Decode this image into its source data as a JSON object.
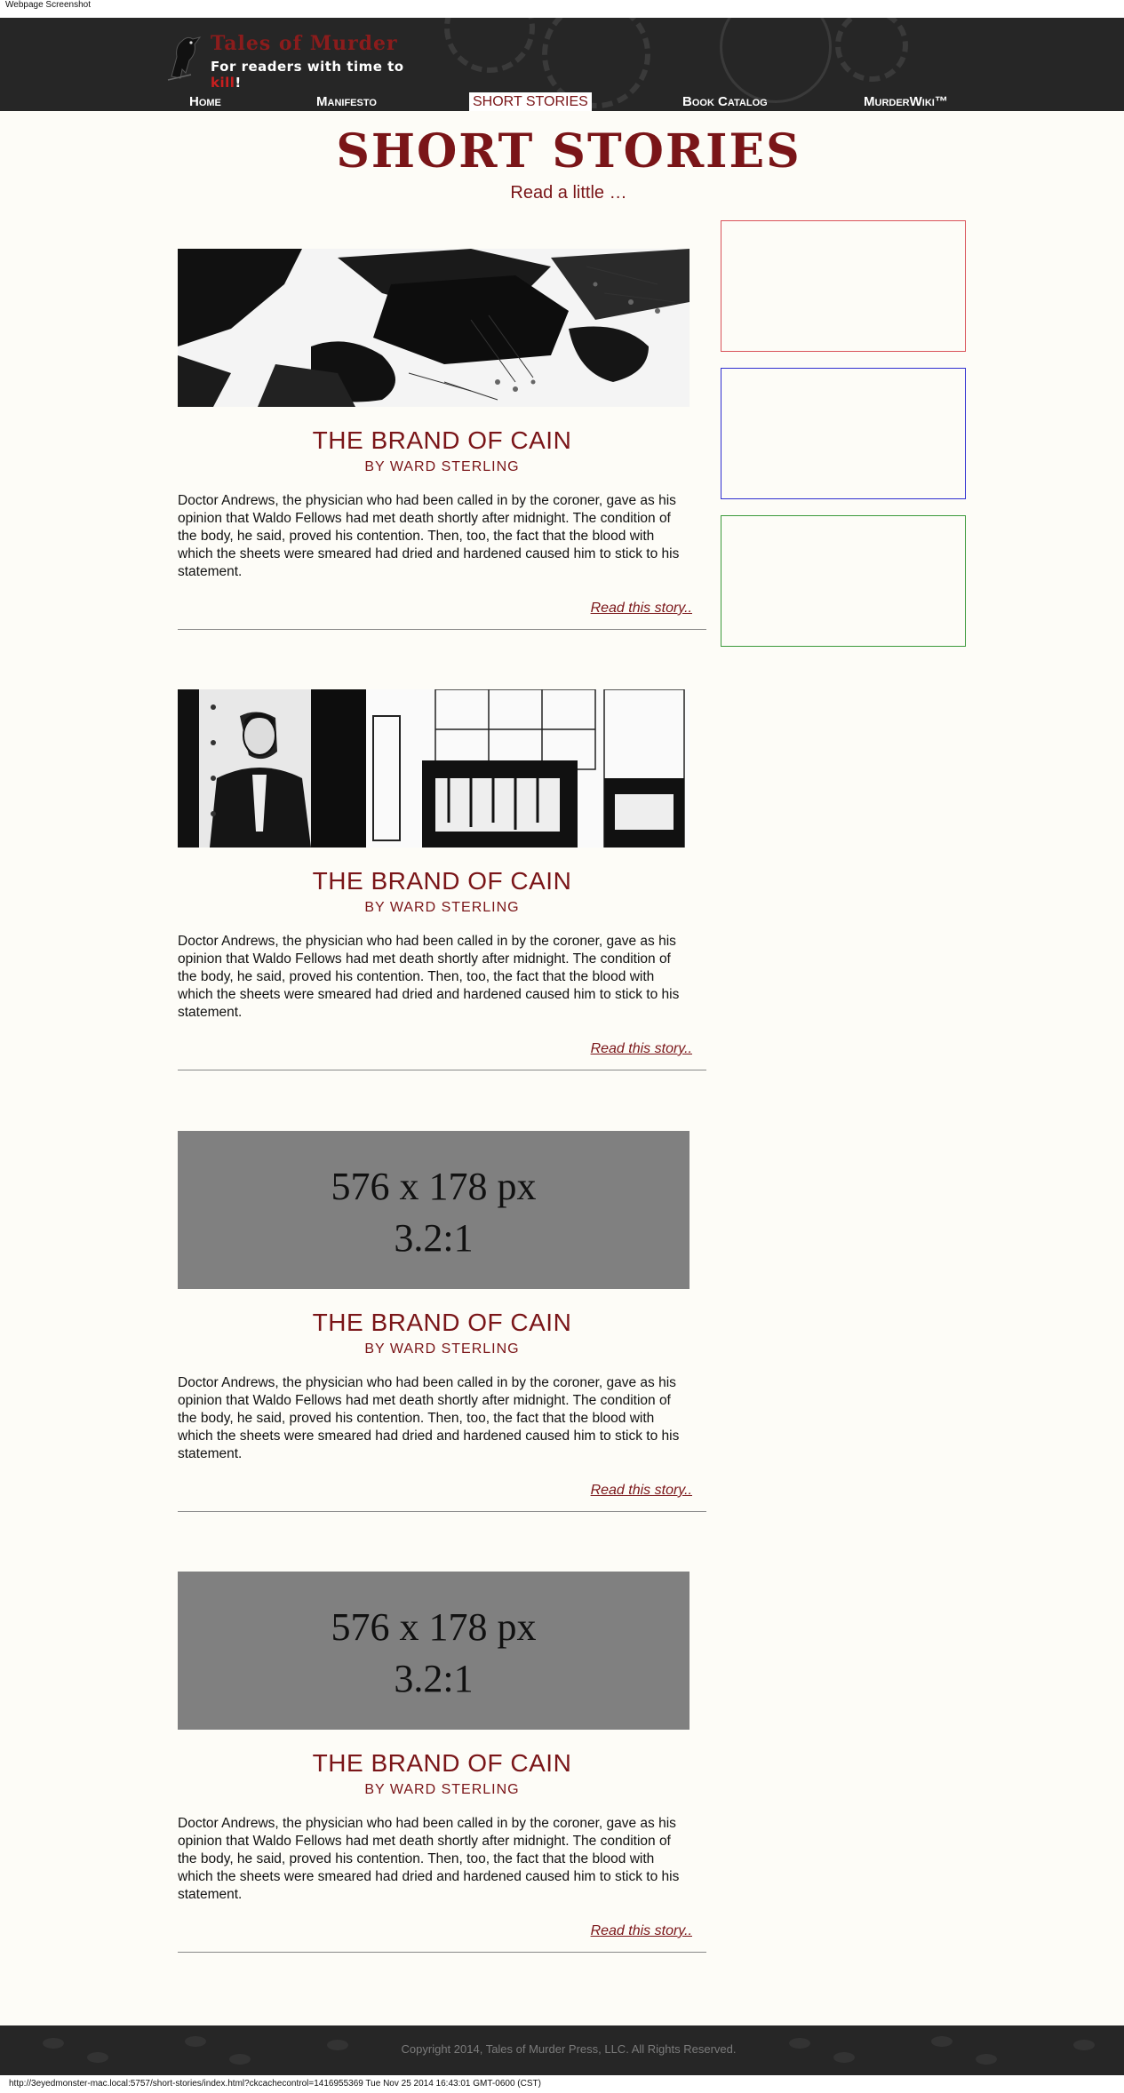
{
  "browser": {
    "window_title": "Webpage Screenshot",
    "status_bar": "http://3eyedmonster-mac.local:5757/short-stories/index.html?ckcachecontrol=1416955369 Tue Nov 25 2014 16:43:01 GMT-0600 (CST)"
  },
  "site": {
    "logo_title": "Tales of Murder",
    "tagline_start": "For readers with time to ",
    "tagline_highlight": "kill",
    "tagline_end": "!"
  },
  "nav": {
    "items": [
      {
        "label": "Home"
      },
      {
        "label": "Manifesto"
      },
      {
        "label": "SHORT STORIES"
      },
      {
        "label": "Book Catalog"
      },
      {
        "label": "MurderWiki™"
      }
    ]
  },
  "page": {
    "title": "SHORT STORIES",
    "subtitle": "Read a little …"
  },
  "stories": [
    {
      "image": "crime-scene-illustration",
      "title": "THE BRAND OF CAIN",
      "byline": "BY WARD STERLING",
      "excerpt": "Doctor Andrews, the physician who had been called in by the coroner, gave as his opinion that Waldo Fellows had met death shortly after midnight. The condition of the body, he said, proved his contention. Then, too, the fact that the blood with which the sheets were smeared had dried and hardened caused him to stick to his statement.",
      "read_link": "Read this story.."
    },
    {
      "image": "man-in-office-illustration",
      "title": "THE BRAND OF CAIN",
      "byline": "BY WARD STERLING",
      "excerpt": "Doctor Andrews, the physician who had been called in by the coroner, gave as his opinion that Waldo Fellows had met death shortly after midnight. The condition of the body, he said, proved his contention. Then, too, the fact that the blood with which the sheets were smeared had dried and hardened caused him to stick to his statement.",
      "read_link": "Read this story.."
    },
    {
      "image": "placeholder",
      "placeholder_line1": "576 x 178 px",
      "placeholder_line2": "3.2:1",
      "title": "THE BRAND OF CAIN",
      "byline": "BY WARD STERLING",
      "excerpt": "Doctor Andrews, the physician who had been called in by the coroner, gave as his opinion that Waldo Fellows had met death shortly after midnight. The condition of the body, he said, proved his contention. Then, too, the fact that the blood with which the sheets were smeared had dried and hardened caused him to stick to his statement.",
      "read_link": "Read this story.."
    },
    {
      "image": "placeholder",
      "placeholder_line1": "576 x 178 px",
      "placeholder_line2": "3.2:1",
      "title": "THE BRAND OF CAIN",
      "byline": "BY WARD STERLING",
      "excerpt": "Doctor Andrews, the physician who had been called in by the coroner, gave as his opinion that Waldo Fellows had met death shortly after midnight. The condition of the body, he said, proved his contention. Then, too, the fact that the blood with which the sheets were smeared had dried and hardened caused him to stick to his statement.",
      "read_link": "Read this story.."
    }
  ],
  "sidebar": {
    "ads": [
      {
        "border_color": "#d9535a"
      },
      {
        "border_color": "#2f2fd0"
      },
      {
        "border_color": "#3c9a3c"
      }
    ]
  },
  "footer": {
    "copyright": "Copyright 2014, Tales of Murder Press, LLC. All Rights Reserved."
  },
  "colors": {
    "brand": "#7a1518",
    "header_bg": "#262626",
    "page_bg": "#fdfcf7"
  }
}
